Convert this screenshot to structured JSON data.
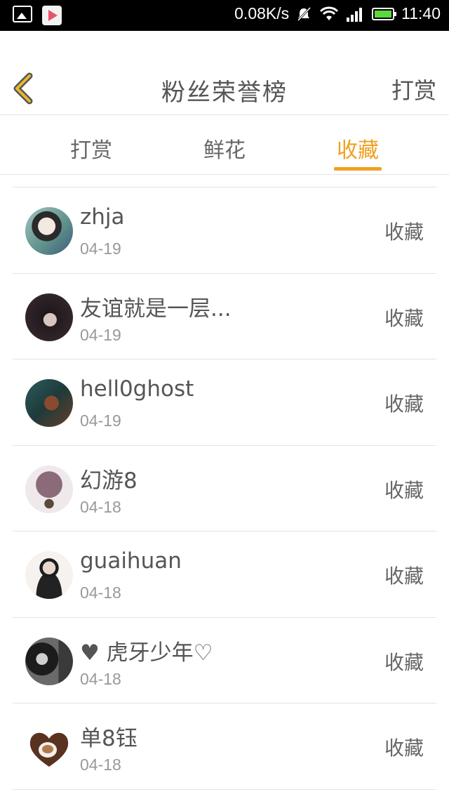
{
  "status_bar": {
    "speed": "0.08K/s",
    "time": "11:40",
    "icons": [
      "image-icon",
      "play-store-icon",
      "bell-muted-icon",
      "wifi-icon",
      "signal-icon",
      "battery-icon"
    ],
    "battery_color": "#59d93c"
  },
  "header": {
    "title": "粉丝荣誉榜",
    "action_label": "打赏",
    "back_icon_color": "#e8b92a"
  },
  "tabs": [
    {
      "label": "打赏",
      "active": false
    },
    {
      "label": "鲜花",
      "active": false
    },
    {
      "label": "收藏",
      "active": true
    }
  ],
  "accent_color": "#f0a020",
  "fans": [
    {
      "name": "zhja",
      "date": "04-19",
      "action": "收藏"
    },
    {
      "name": "友谊就是一层...",
      "date": "04-19",
      "action": "收藏"
    },
    {
      "name": "hell0ghost",
      "date": "04-19",
      "action": "收藏"
    },
    {
      "name": "幻游8",
      "date": "04-18",
      "action": "收藏"
    },
    {
      "name": "guaihuan",
      "date": "04-18",
      "action": "收藏"
    },
    {
      "name": "♥ 虎牙少年♡",
      "date": "04-18",
      "action": "收藏"
    },
    {
      "name": "单8钰",
      "date": "04-18",
      "action": "收藏"
    }
  ]
}
